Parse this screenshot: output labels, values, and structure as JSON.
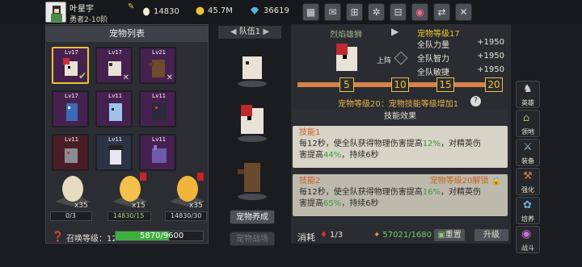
{
  "player": {
    "name": "叶星宇",
    "rank": "勇者2-10阶"
  },
  "resources": [
    {
      "icon": "egg-icon",
      "value": "14830"
    },
    {
      "icon": "gold-coin-icon",
      "value": "45.7M"
    },
    {
      "icon": "gem-icon",
      "value": "36619"
    }
  ],
  "toolbar": [
    "store-icon",
    "mail-icon",
    "gamepad-icon",
    "settings-icon",
    "gift-icon",
    "wheel-icon",
    "recharge-icon",
    "close-icon"
  ],
  "left": {
    "title": "宠物列表",
    "pets": [
      {
        "lv": "Lv17",
        "cls": "sel",
        "check": true
      },
      {
        "lv": "Lv17",
        "cls": "",
        "x": true
      },
      {
        "lv": "Lv21",
        "cls": "",
        "x": true
      },
      {
        "lv": "Lv17",
        "cls": "",
        "x": false
      },
      {
        "lv": "Lv11",
        "cls": "",
        "x": false
      },
      {
        "lv": "Lv11",
        "cls": "",
        "x": false
      },
      {
        "lv": "Lv11",
        "cls": "red",
        "x": false
      },
      {
        "lv": "Lv11",
        "cls": "blue",
        "x": false
      },
      {
        "lv": "Lv11",
        "cls": "",
        "x": false
      }
    ],
    "eggs": [
      {
        "count": "x35",
        "has": "0/3"
      },
      {
        "count": "x15",
        "has": "14830/15"
      },
      {
        "count": "x35",
        "has": "14830/30"
      }
    ],
    "summon_label": "召唤等级：12",
    "summon_progress": "5870/9600",
    "summon_fraction": 0.61
  },
  "middle": {
    "team_label": "队伍1",
    "train_label": "宠物养成",
    "combat_label": "宠物战场"
  },
  "right": {
    "pet_name": "烈焰雄狮",
    "pet_level": "宠物等级17",
    "deploy_label": "上阵",
    "stats": [
      {
        "label": "全队力量",
        "value": "+1950"
      },
      {
        "label": "全队智力",
        "value": "+1950"
      },
      {
        "label": "全队敏捷",
        "value": "+1950"
      }
    ],
    "milestones": [
      "5",
      "10",
      "15",
      "20"
    ],
    "level_bonus": "宠物等级20：宠物技能等级增加1",
    "skill_header": "技能效果",
    "skill1": {
      "name": "技能1",
      "line1a": "每12秒，使全队获得物理伤害提高",
      "line1b": "12%",
      "line1c": "，对精英伤",
      "line2a": "害提高",
      "line2b": "44%",
      "line2c": "，持续6秒"
    },
    "skill2": {
      "name": "技能2",
      "unlock": "宠物等级20解锁",
      "line1a": "每12秒，使全队获得物理伤害提高",
      "line1b": "16%",
      "line1c": "，对精英伤",
      "line2a": "害提高",
      "line2b": "65%",
      "line2c": "，持续6秒"
    },
    "cost_label": "消耗",
    "cost1": "1/3",
    "cost2": "57021/1680",
    "reset_label": "重置",
    "upgrade_label": "升级"
  },
  "side": [
    {
      "label": "英雄",
      "icon": "hero-icon"
    },
    {
      "label": "领地",
      "icon": "territory-icon"
    },
    {
      "label": "装备",
      "icon": "equipment-icon"
    },
    {
      "label": "强化",
      "icon": "enhance-icon"
    },
    {
      "label": "培养",
      "icon": "cultivate-icon"
    },
    {
      "label": "战斗",
      "icon": "battle-icon"
    }
  ]
}
